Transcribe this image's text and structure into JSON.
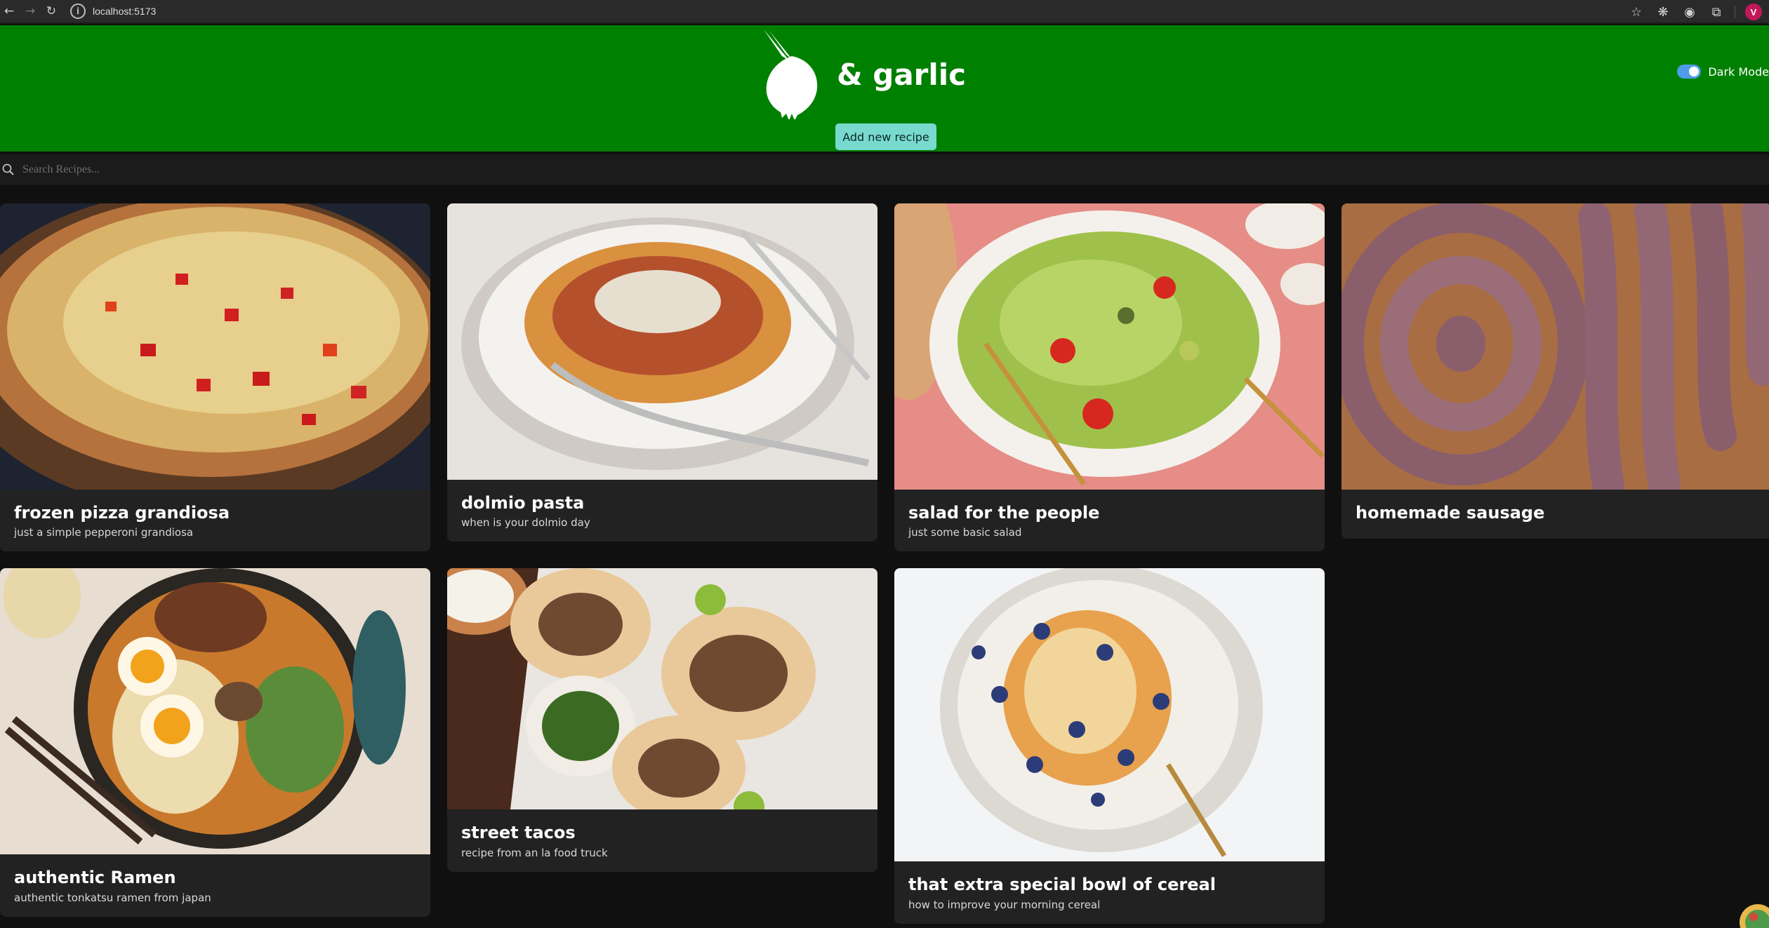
{
  "browser": {
    "url": "localhost:5173",
    "profile_initial": "V"
  },
  "header": {
    "title": "& garlic",
    "add_button": "Add new recipe",
    "dark_mode_label": "Dark Mode",
    "dark_mode_on": true,
    "accent": "#008000"
  },
  "search": {
    "placeholder": "Search Recipes..."
  },
  "recipes": [
    {
      "title": "frozen pizza grandiosa",
      "description": "just a simple pepperoni grandiosa"
    },
    {
      "title": "dolmio pasta",
      "description": "when is your dolmio day"
    },
    {
      "title": "salad for the people",
      "description": "just some basic salad"
    },
    {
      "title": "homemade sausage",
      "description": ""
    },
    {
      "title": "authentic Ramen",
      "description": "authentic tonkatsu ramen from japan"
    },
    {
      "title": "street tacos",
      "description": "recipe from an la food truck"
    },
    {
      "title": "that extra special bowl of cereal",
      "description": "how to improve your morning cereal"
    }
  ]
}
